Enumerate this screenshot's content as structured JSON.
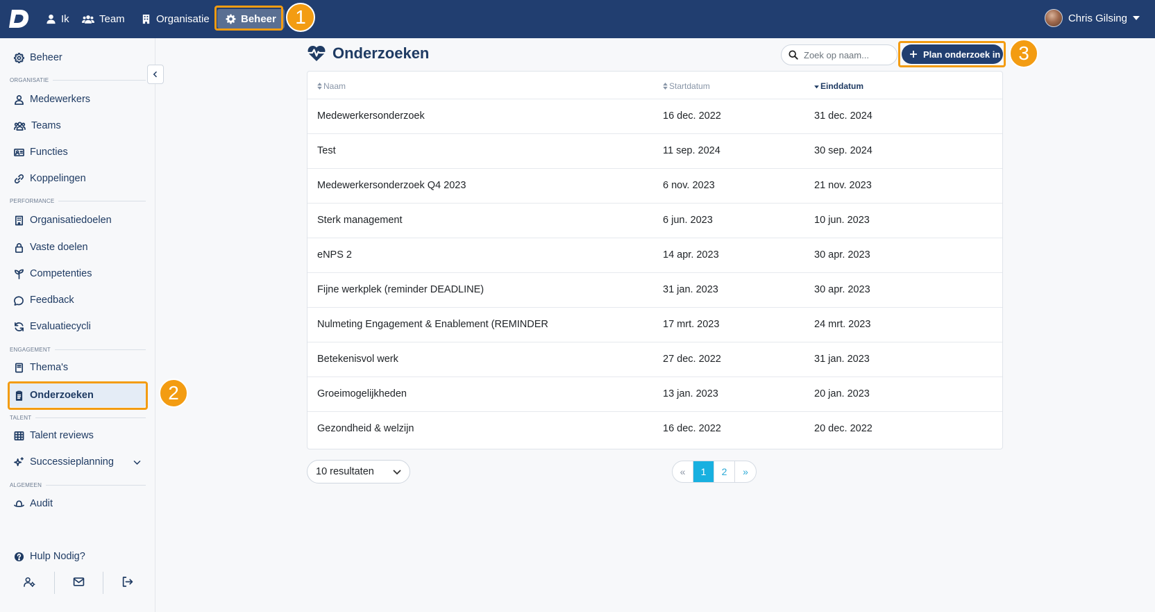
{
  "topnav": {
    "items": [
      {
        "label": "Ik",
        "icon": "user-icon"
      },
      {
        "label": "Team",
        "icon": "users-icon"
      },
      {
        "label": "Organisatie",
        "icon": "building-icon"
      },
      {
        "label": "Beheer",
        "icon": "gear-icon",
        "active": true
      }
    ],
    "user_name": "Chris Gilsing"
  },
  "callouts": [
    "1",
    "2",
    "3"
  ],
  "sidebar": {
    "top_item": "Beheer",
    "sections": [
      {
        "title": "ORGANISATIE",
        "items": [
          "Medewerkers",
          "Teams",
          "Functies",
          "Koppelingen"
        ]
      },
      {
        "title": "PERFORMANCE",
        "items": [
          "Organisatiedoelen",
          "Vaste doelen",
          "Competenties",
          "Feedback",
          "Evaluatiecycli"
        ]
      },
      {
        "title": "ENGAGEMENT",
        "items": [
          "Thema's",
          "Onderzoeken"
        ]
      },
      {
        "title": "TALENT",
        "items": [
          "Talent reviews",
          "Successieplanning"
        ]
      },
      {
        "title": "ALGEMEEN",
        "items": [
          "Audit"
        ]
      }
    ],
    "help": "Hulp Nodig?"
  },
  "page": {
    "title": "Onderzoeken",
    "search_placeholder": "Zoek op naam...",
    "plan_button": "Plan onderzoek in"
  },
  "table": {
    "columns": [
      "Naam",
      "Startdatum",
      "Einddatum"
    ],
    "sorted_column": "Einddatum",
    "rows": [
      [
        "Medewerkersonderzoek",
        "16 dec. 2022",
        "31 dec. 2024"
      ],
      [
        "Test",
        "11 sep. 2024",
        "30 sep. 2024"
      ],
      [
        "Medewerkersonderzoek Q4 2023",
        "6 nov. 2023",
        "21 nov. 2023"
      ],
      [
        "Sterk management",
        "6 jun. 2023",
        "10 jun. 2023"
      ],
      [
        "eNPS 2",
        "14 apr. 2023",
        "30 apr. 2023"
      ],
      [
        "Fijne werkplek (reminder DEADLINE)",
        "31 jan. 2023",
        "30 apr. 2023"
      ],
      [
        "Nulmeting Engagement & Enablement (REMINDER",
        "17 mrt. 2023",
        "24 mrt. 2023"
      ],
      [
        "Betekenisvol werk",
        "27 dec. 2022",
        "31 jan. 2023"
      ],
      [
        "Groeimogelijkheden",
        "13 jan. 2023",
        "20 jan. 2023"
      ],
      [
        "Gezondheid & welzijn",
        "16 dec. 2022",
        "20 dec. 2022"
      ]
    ]
  },
  "pagination": {
    "per_page": "10 resultaten",
    "prev": "«",
    "pages": [
      "1",
      "2"
    ],
    "current": "1",
    "next": "»"
  },
  "colors": {
    "navbar": "#213e70",
    "callout": "#f39c12",
    "active_page": "#18b0e0"
  }
}
